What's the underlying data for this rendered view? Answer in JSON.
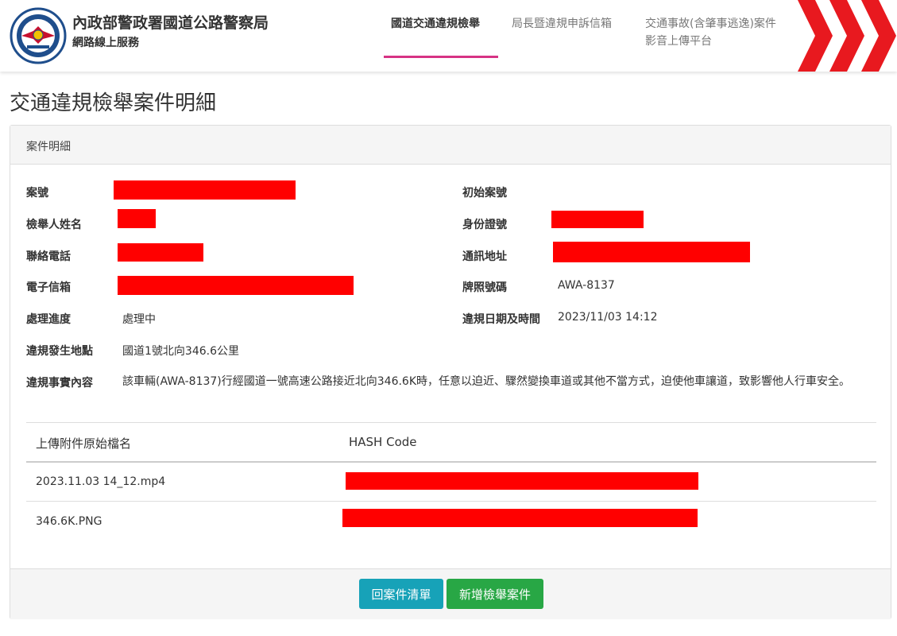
{
  "header": {
    "org_title": "內政部警政署國道公路警察局",
    "org_subtitle": "網路線上服務",
    "nav": [
      {
        "label": "國道交通違規檢舉",
        "active": true
      },
      {
        "label": "局長暨違規申訴信箱",
        "active": false
      },
      {
        "label_line1": "交通事故(含肇事逃逸)案件",
        "label_line2": "影音上傳平台",
        "active": false
      }
    ]
  },
  "page_title": "交通違規檢舉案件明細",
  "panel": {
    "heading": "案件明細",
    "fields": {
      "case_no_label": "案號",
      "original_case_no_label": "初始案號",
      "reporter_name_label": "檢舉人姓名",
      "id_no_label": "身份證號",
      "phone_label": "聯絡電話",
      "address_label": "通訊地址",
      "email_label": "電子信箱",
      "plate_label": "牌照號碼",
      "plate_value": "AWA-8137",
      "status_label": "處理進度",
      "status_value": "處理中",
      "datetime_label": "違規日期及時間",
      "datetime_value": "2023/11/03 14:12",
      "location_label": "違規發生地點",
      "location_value": "國道1號北向346.6公里",
      "facts_label": "違規事實內容",
      "facts_value": "該車輛(AWA-8137)行經國道一號高速公路接近北向346.6K時，任意以迫近、驟然變換車道或其他不當方式，迫使他車讓道，致影響他人行車安全。"
    },
    "attachments": {
      "col_filename": "上傳附件原始檔名",
      "col_hash": "HASH Code",
      "rows": [
        {
          "filename": "2023.11.03 14_12.mp4"
        },
        {
          "filename": "346.6K.PNG"
        }
      ]
    },
    "buttons": {
      "back": "回案件清單",
      "new": "新增檢舉案件"
    }
  },
  "colors": {
    "accent_underline": "#d63384",
    "redaction": "#ff0000",
    "btn_info": "#17a2b8",
    "btn_success": "#28a745",
    "chevron": "#e8191f"
  }
}
